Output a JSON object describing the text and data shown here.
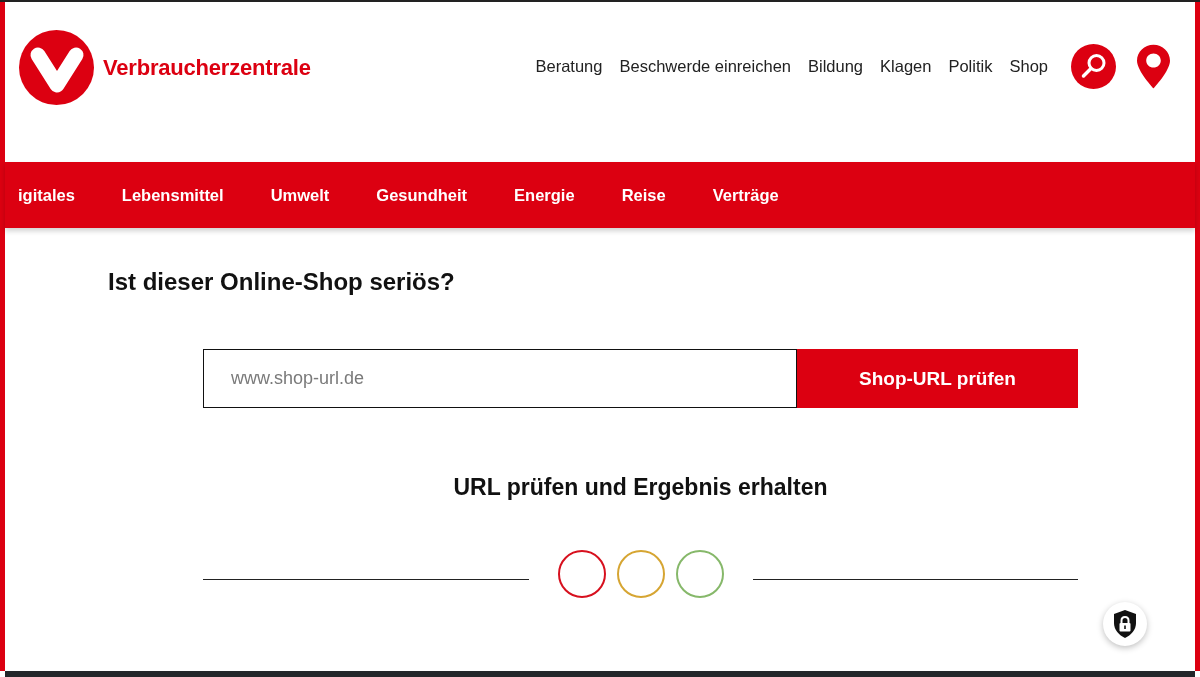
{
  "header": {
    "logo_text": "Verbraucherzentrale",
    "nav_links": [
      "Beratung",
      "Beschwerde einreichen",
      "Bildung",
      "Klagen",
      "Politik",
      "Shop"
    ]
  },
  "category_nav": [
    "igitales",
    "Lebensmittel",
    "Umwelt",
    "Gesundheit",
    "Energie",
    "Reise",
    "Verträge"
  ],
  "shop_check": {
    "title": "Ist dieser Online-Shop seriös?",
    "url_field": {
      "placeholder": "www.shop-url.de"
    },
    "submit_button": "Shop-URL prüfen",
    "result_heading": "URL prüfen und Ergebnis erhalten",
    "indicators": [
      {
        "color": "#d7101e"
      },
      {
        "color": "#d6a532"
      },
      {
        "color": "#86b86a"
      }
    ]
  }
}
